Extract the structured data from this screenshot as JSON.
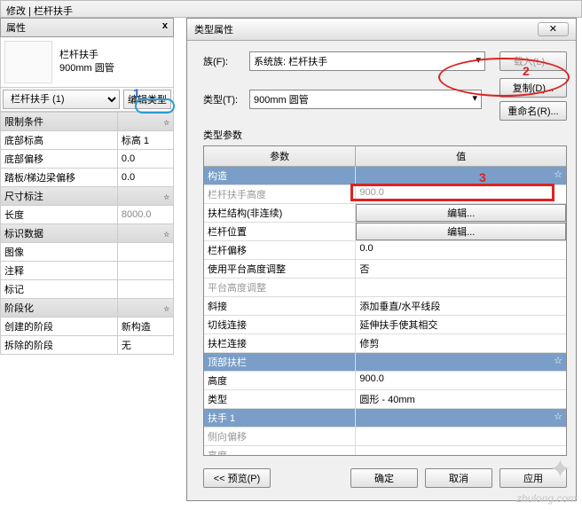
{
  "titlebar": "修改 | 栏杆扶手",
  "propHeader": {
    "title": "属性",
    "close": "x"
  },
  "thumb": {
    "line1": "栏杆扶手",
    "line2": "900mm 圆管"
  },
  "selector": {
    "label": "栏杆扶手 (1)",
    "editType": "编辑类型"
  },
  "markers": {
    "m1": "1",
    "m2": "2",
    "m3": "3"
  },
  "groups": {
    "constraints": "限制条件",
    "dims": "尺寸标注",
    "identity": "标识数据",
    "phasing": "阶段化"
  },
  "props": {
    "baseLevel": {
      "name": "底部标高",
      "value": "标高 1"
    },
    "baseOffset": {
      "name": "底部偏移",
      "value": "0.0"
    },
    "tread": {
      "name": "踏板/梯边梁偏移",
      "value": "0.0"
    },
    "length": {
      "name": "长度",
      "value": "8000.0"
    },
    "image": {
      "name": "图像",
      "value": ""
    },
    "comments": {
      "name": "注释",
      "value": ""
    },
    "mark": {
      "name": "标记",
      "value": ""
    },
    "createdPhase": {
      "name": "创建的阶段",
      "value": "新构造"
    },
    "demoPhase": {
      "name": "拆除的阶段",
      "value": "无"
    }
  },
  "dialog": {
    "title": "类型属性",
    "family": {
      "label": "族(F):",
      "value": "系统族: 栏杆扶手",
      "loadBtn": "载入(L)..."
    },
    "type": {
      "label": "类型(T):",
      "value": "900mm 圆管",
      "copyBtn": "复制(D)...",
      "renameBtn": "重命名(R)..."
    },
    "paramsLabel": "类型参数",
    "headParam": "参数",
    "headValue": "值",
    "grpConstruction": "构造",
    "railHeight": {
      "name": "栏杆扶手高度",
      "value": "900.0"
    },
    "balStruct": {
      "name": "扶栏结构(非连续)",
      "value": "编辑..."
    },
    "balPos": {
      "name": "栏杆位置",
      "value": "编辑..."
    },
    "balOffset": {
      "name": "栏杆偏移",
      "value": "0.0"
    },
    "landingAdj": {
      "name": "使用平台高度调整",
      "value": "否"
    },
    "landingHeight": {
      "name": "平台高度调整",
      "value": ""
    },
    "angJoin": {
      "name": "斜接",
      "value": "添加垂直/水平线段"
    },
    "tanJoin": {
      "name": "切线连接",
      "value": "延伸扶手使其相交"
    },
    "railConn": {
      "name": "扶栏连接",
      "value": "修剪"
    },
    "grpTopRail": "顶部扶栏",
    "trHeight": {
      "name": "高度",
      "value": "900.0"
    },
    "trType": {
      "name": "类型",
      "value": "圆形 - 40mm"
    },
    "grpHand1": "扶手 1",
    "latOffset": {
      "name": "侧向偏移",
      "value": ""
    },
    "h1Height": {
      "name": "高度",
      "value": ""
    },
    "footer": {
      "preview": "<< 预览(P)",
      "ok": "确定",
      "cancel": "取消",
      "apply": "应用"
    }
  },
  "watermark": "zhulong.com",
  "collapse": "☆"
}
